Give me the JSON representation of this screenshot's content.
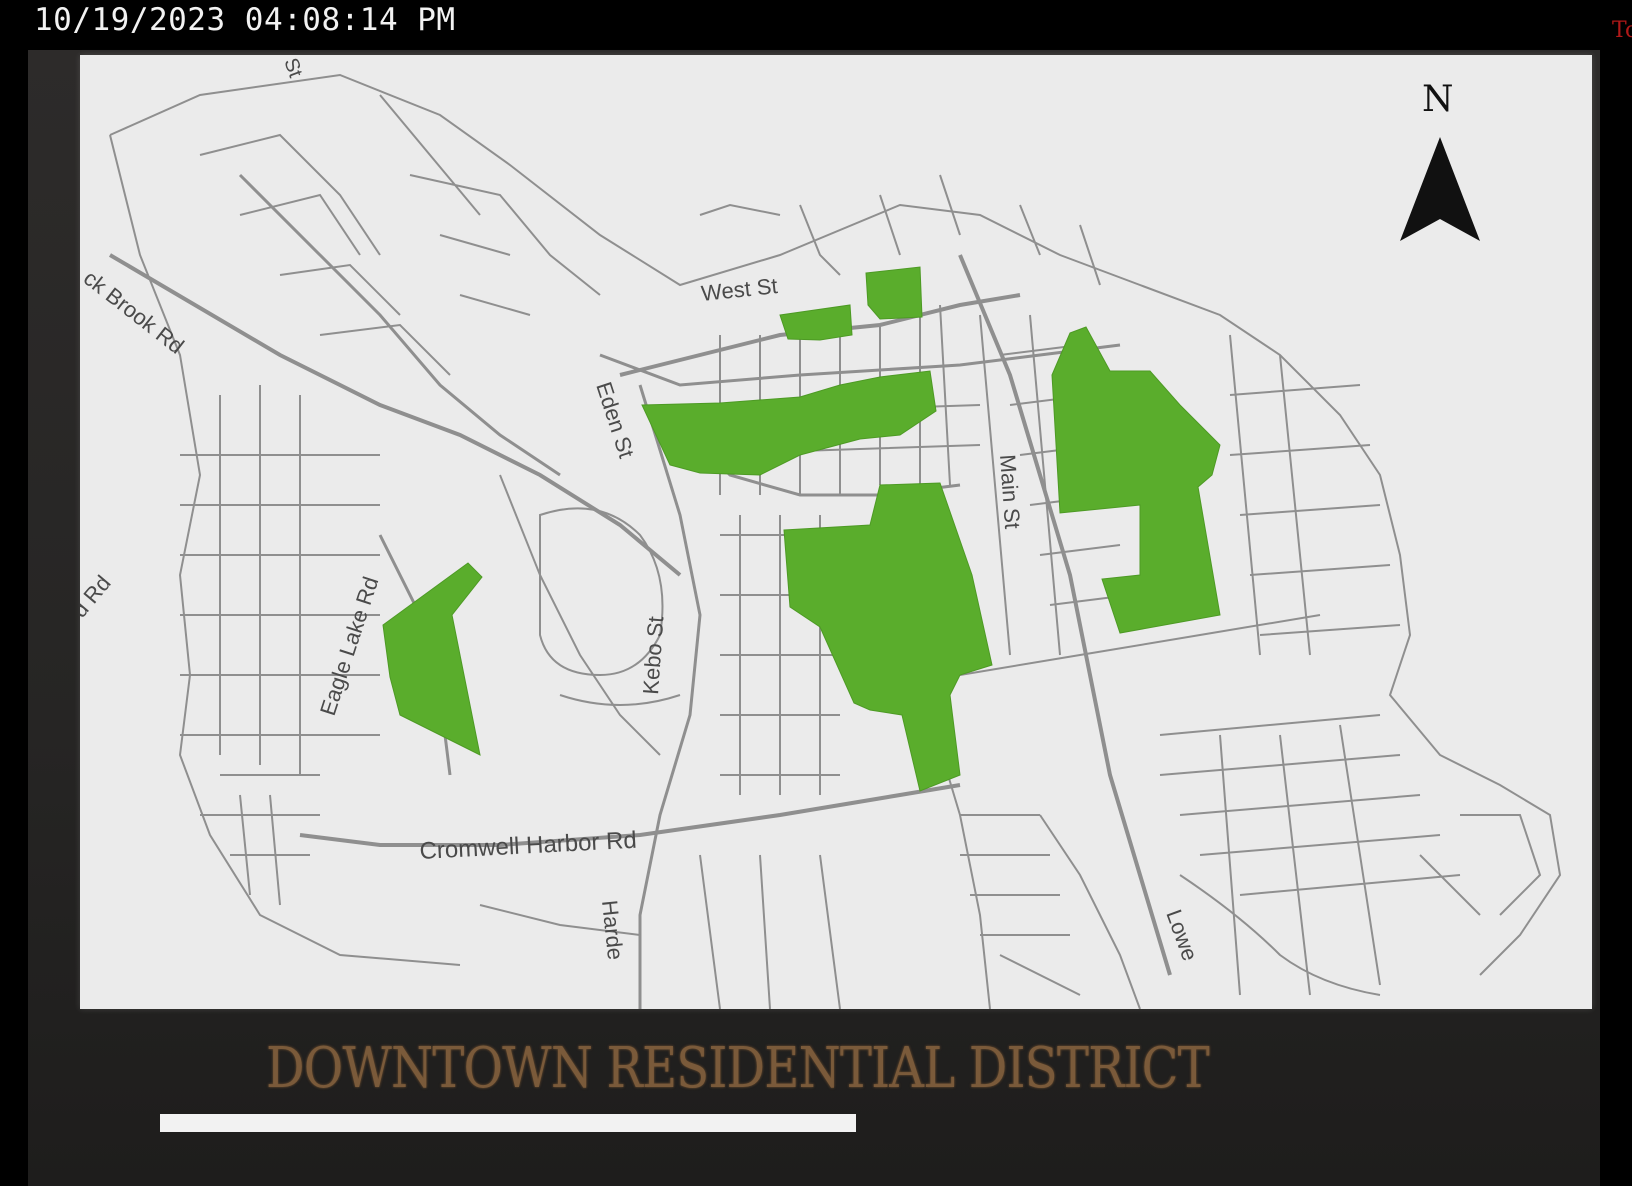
{
  "timestamp": "10/19/2023 04:08:14 PM",
  "slide_title": "DOWNTOWN RESIDENTIAL DISTRICT",
  "map": {
    "north_label": "N",
    "road_labels": {
      "west_st": "West St",
      "brook_rd": "ck Brook Rd",
      "eden_st": "Eden St",
      "main_st": "Main St",
      "rd_left": "d Rd",
      "eagle_lake_rd": "Eagle Lake Rd",
      "kebo_st": "Kebo St",
      "cromwell_harbor_rd": "Cromwell Harbor Rd",
      "harden": "Harde",
      "lower": "Lowe",
      "st_top": "St"
    },
    "colors": {
      "district_fill": "#5aad2c",
      "road_line": "#8a8a8a",
      "map_background": "#ebebeb"
    }
  },
  "logo_text": "Tc"
}
